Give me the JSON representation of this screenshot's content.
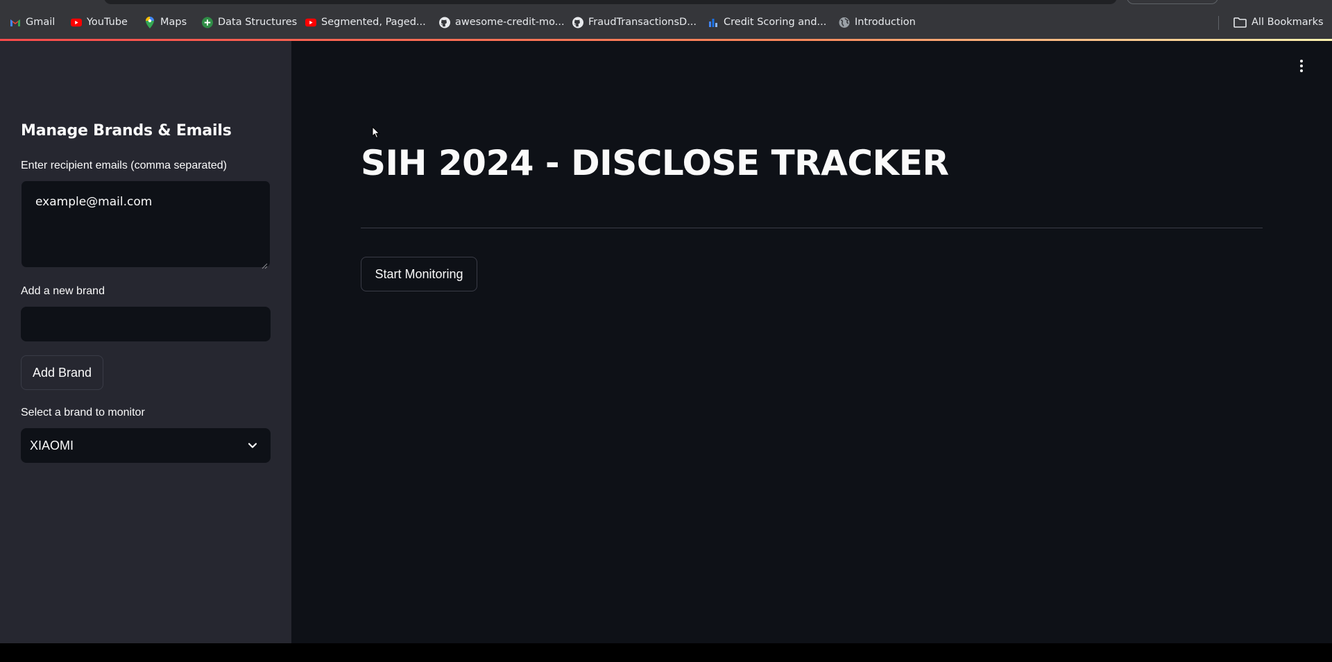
{
  "bookmarks": [
    {
      "label": "Gmail",
      "icon": "gmail-icon"
    },
    {
      "label": "YouTube",
      "icon": "youtube-icon"
    },
    {
      "label": "Maps",
      "icon": "maps-icon"
    },
    {
      "label": "Data Structures",
      "icon": "green-logo-icon"
    },
    {
      "label": "Segmented, Paged...",
      "icon": "youtube-icon"
    },
    {
      "label": "awesome-credit-mo...",
      "icon": "github-icon"
    },
    {
      "label": "FraudTransactionsD...",
      "icon": "github-icon"
    },
    {
      "label": "Credit Scoring and...",
      "icon": "bar-chart-icon"
    },
    {
      "label": "Introduction",
      "icon": "globe-icon"
    }
  ],
  "all_bookmarks": {
    "label": "All Bookmarks",
    "icon": "folder-icon"
  },
  "sidebar": {
    "title": "Manage Brands & Emails",
    "emails_label": "Enter recipient emails (comma separated)",
    "emails_value": "example@mail.com",
    "brand_label": "Add a new brand",
    "brand_value": "",
    "add_brand_button": "Add Brand",
    "select_label": "Select a brand to monitor",
    "select_value": "XIAOMI"
  },
  "main": {
    "title": "SIH 2024 - DISCLOSE TRACKER",
    "start_button": "Start Monitoring"
  },
  "colors": {
    "app_background": "#0e1117",
    "sidebar_background": "#262730",
    "text": "#fafafa",
    "accent": "#ff4b4b",
    "bookmarks_bar": "#35363a"
  }
}
